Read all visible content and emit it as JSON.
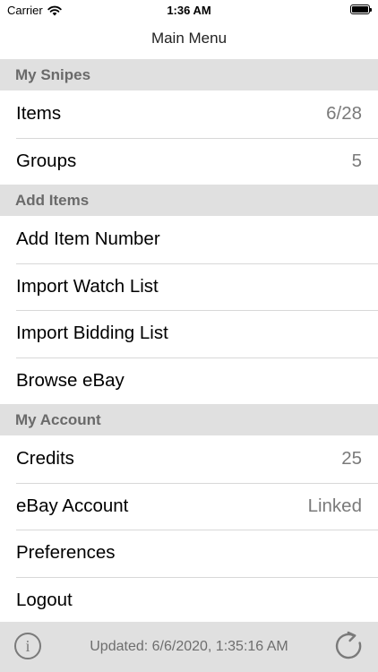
{
  "status_bar": {
    "carrier": "Carrier",
    "time": "1:36 AM"
  },
  "nav": {
    "title": "Main Menu"
  },
  "sections": [
    {
      "header": "My Snipes",
      "rows": [
        {
          "label": "Items",
          "value": "6/28"
        },
        {
          "label": "Groups",
          "value": "5"
        }
      ]
    },
    {
      "header": "Add Items",
      "rows": [
        {
          "label": "Add Item Number",
          "value": ""
        },
        {
          "label": "Import Watch List",
          "value": ""
        },
        {
          "label": "Import Bidding List",
          "value": ""
        },
        {
          "label": "Browse eBay",
          "value": ""
        }
      ]
    },
    {
      "header": "My Account",
      "rows": [
        {
          "label": "Credits",
          "value": "25"
        },
        {
          "label": "eBay Account",
          "value": "Linked"
        },
        {
          "label": "Preferences",
          "value": ""
        },
        {
          "label": "Logout",
          "value": ""
        }
      ]
    }
  ],
  "toolbar": {
    "info_label": "i",
    "updated_text": "Updated:  6/6/2020, 1:35:16 AM"
  },
  "icons": {
    "info": "info-icon",
    "refresh": "refresh-icon",
    "wifi": "wifi-icon",
    "battery": "battery-icon"
  },
  "colors": {
    "section_bg": "#e0e0e0",
    "section_text": "#6a6a6a",
    "value_text": "#7a7a7a",
    "separator": "#d8d8d8"
  }
}
